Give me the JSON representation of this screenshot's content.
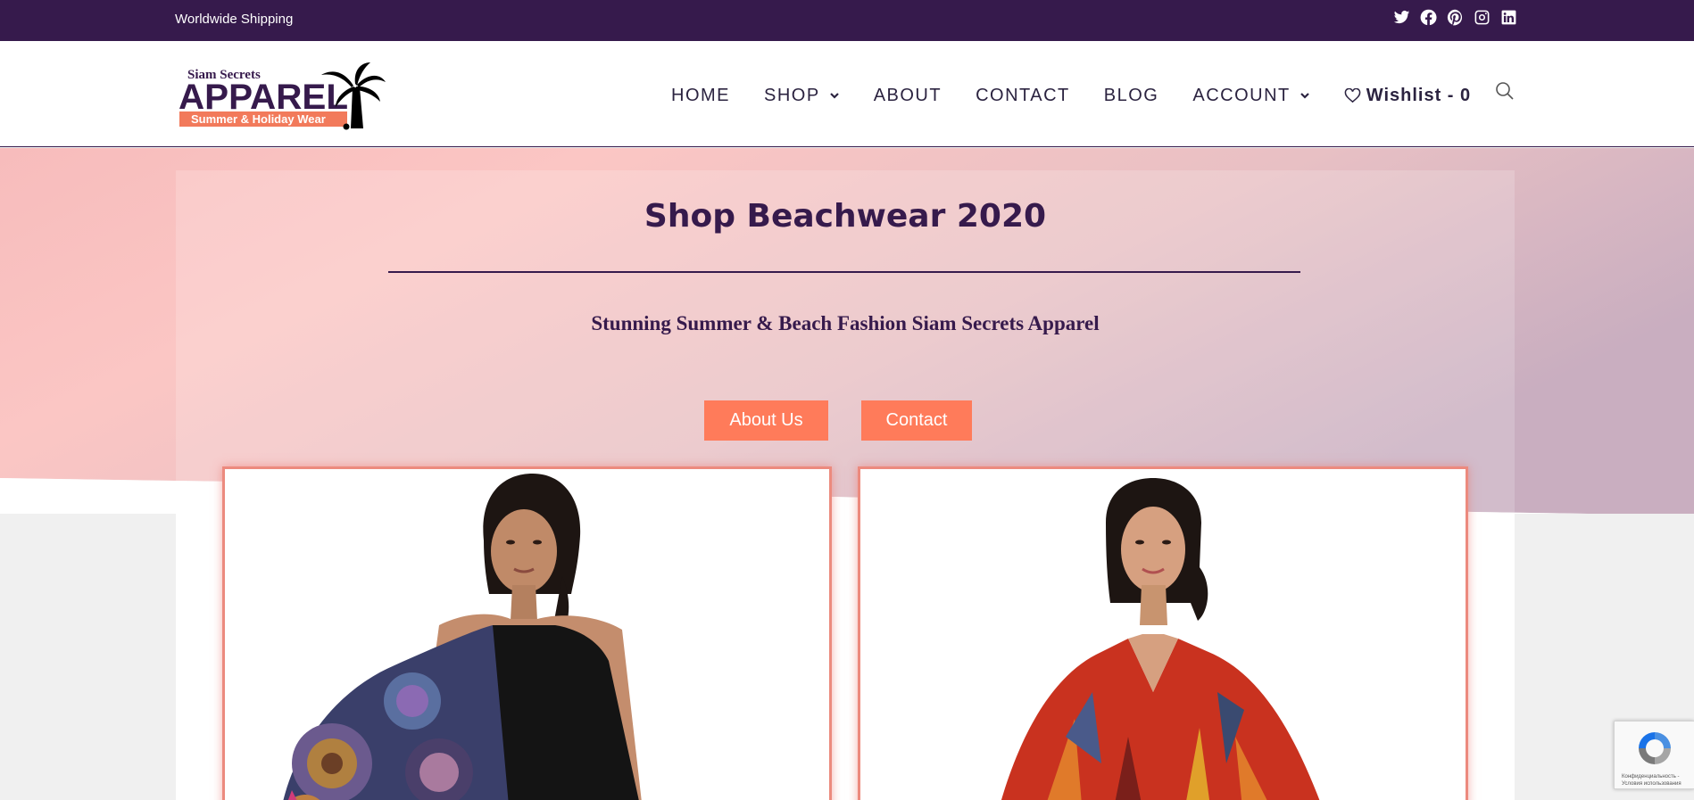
{
  "topbar": {
    "shipping_text": "Worldwide Shipping",
    "social_icons": [
      "twitter-icon",
      "facebook-icon",
      "pinterest-icon",
      "instagram-icon",
      "linkedin-icon"
    ]
  },
  "header": {
    "logo": {
      "line1": "Siam Secrets",
      "line2": "APPAREL",
      "tagline": "Summer & Holiday Wear"
    },
    "nav": {
      "home": "HOME",
      "shop": "SHOP",
      "about": "ABOUT",
      "contact": "CONTACT",
      "blog": "BLOG",
      "account": "ACCOUNT",
      "wishlist": "Wishlist - 0"
    }
  },
  "hero": {
    "title": "Shop Beachwear 2020",
    "subtitle": "Stunning Summer & Beach Fashion Siam Secrets Apparel",
    "buttons": {
      "about": "About Us",
      "contact": "Contact"
    }
  },
  "recaptcha": {
    "line1": "Конфиденциальность -",
    "line2": "Условия использования"
  },
  "colors": {
    "brand_purple": "#361a4c",
    "accent_coral": "#ff7b5a",
    "card_border": "#ec8a7e"
  }
}
